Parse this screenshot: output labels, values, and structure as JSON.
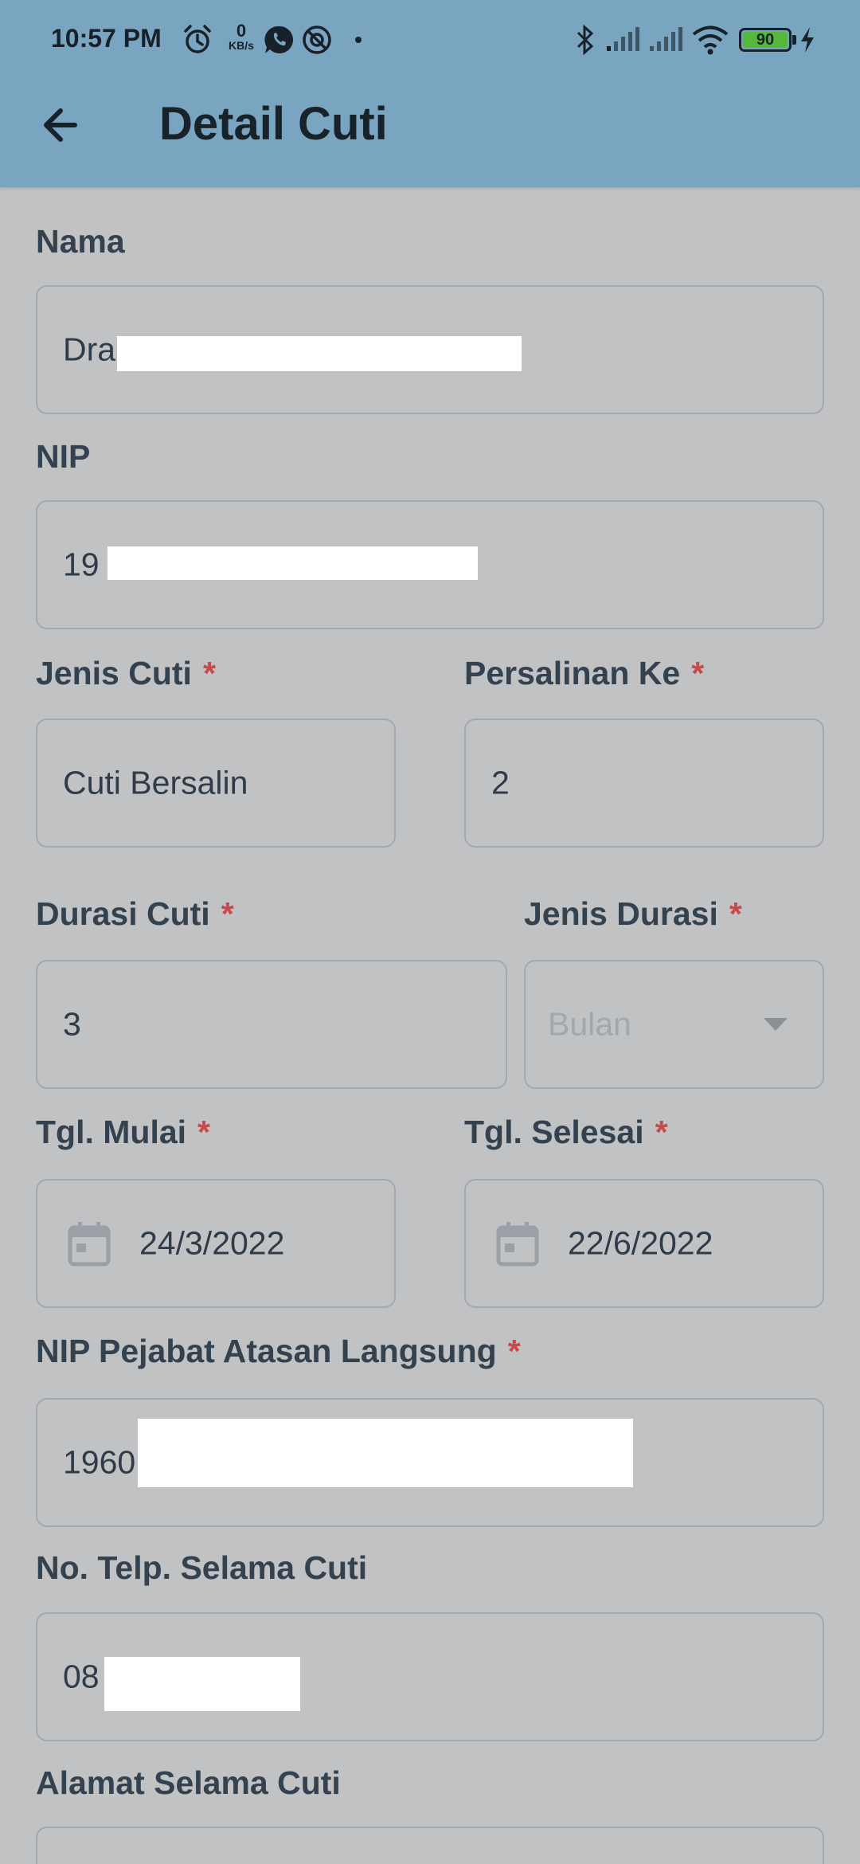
{
  "status_bar": {
    "time": "10:57 PM",
    "net_speed_value": "0",
    "net_speed_unit": "KB/s",
    "battery": "90",
    "icons": [
      "alarm-icon",
      "whatsapp-icon",
      "sync-icon",
      "bluetooth-icon",
      "signal-icon",
      "signal-icon",
      "wifi-icon",
      "battery-icon",
      "charging-icon"
    ]
  },
  "app_bar": {
    "title": "Detail Cuti",
    "back_icon": "arrow-left-icon"
  },
  "form": {
    "nama": {
      "label": "Nama",
      "value": "Dra"
    },
    "nip": {
      "label": "NIP",
      "value": "19"
    },
    "jenis_cuti": {
      "label": "Jenis Cuti",
      "required": "*",
      "value": "Cuti Bersalin"
    },
    "persalinan_ke": {
      "label": "Persalinan Ke",
      "required": "*",
      "value": "2"
    },
    "durasi_cuti": {
      "label": "Durasi Cuti",
      "required": "*",
      "value": "3"
    },
    "jenis_durasi": {
      "label": "Jenis Durasi",
      "required": "*",
      "value": "Bulan"
    },
    "tgl_mulai": {
      "label": "Tgl. Mulai",
      "required": "*",
      "value": "24/3/2022"
    },
    "tgl_selesai": {
      "label": "Tgl. Selesai",
      "required": "*",
      "value": "22/6/2022"
    },
    "nip_atasan": {
      "label": "NIP Pejabat Atasan Langsung",
      "required": "*",
      "value": "1960"
    },
    "no_telp": {
      "label": "No. Telp. Selama Cuti",
      "value": "08"
    },
    "alamat": {
      "label": "Alamat Selama Cuti",
      "value": ""
    }
  },
  "colors": {
    "app_bar": "#79a5c0",
    "background": "#c0c2c4",
    "required": "#c64a4a",
    "battery": "#55b83a"
  }
}
